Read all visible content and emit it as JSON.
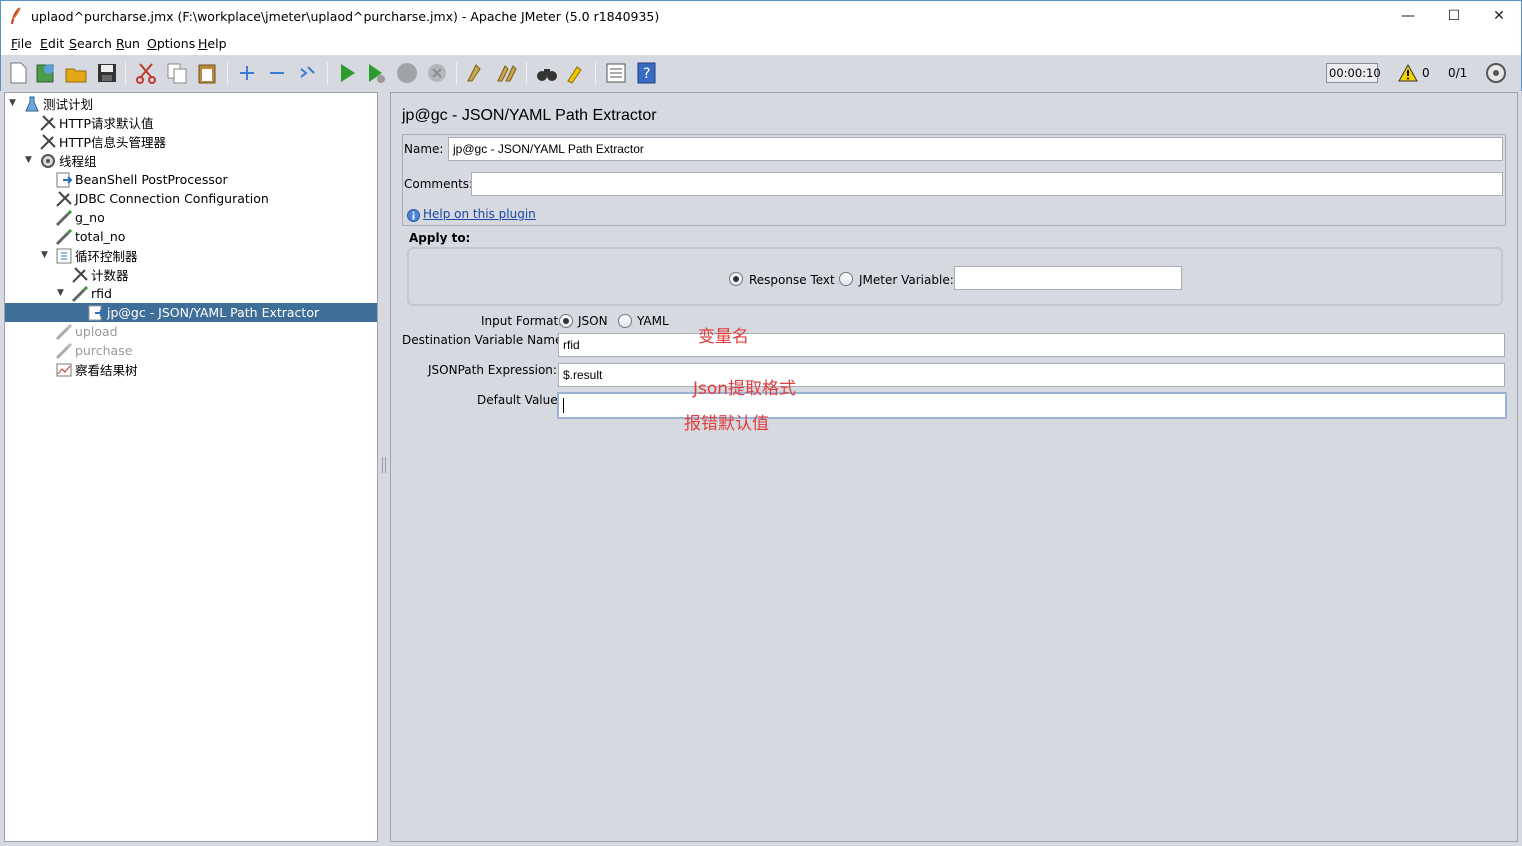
{
  "window": {
    "title": "uplaod^purcharse.jmx (F:\\workplace\\jmeter\\uplaod^purcharse.jmx) - Apache JMeter (5.0 r1840935)",
    "minimize": "—",
    "maximize": "☐",
    "close": "✕"
  },
  "menu": {
    "file": "File",
    "edit": "Edit",
    "search": "Search",
    "run": "Run",
    "options": "Options",
    "help": "Help"
  },
  "toolbar": {
    "timer": "00:00:10",
    "warning_count": "0",
    "threads": "0/1"
  },
  "tree": {
    "items": [
      {
        "label": "测试计划"
      },
      {
        "label": "HTTP请求默认值"
      },
      {
        "label": "HTTP信息头管理器"
      },
      {
        "label": "线程组"
      },
      {
        "label": "BeanShell PostProcessor"
      },
      {
        "label": "JDBC Connection Configuration"
      },
      {
        "label": "g_no"
      },
      {
        "label": "total_no"
      },
      {
        "label": "循环控制器"
      },
      {
        "label": "计数器"
      },
      {
        "label": "rfid"
      },
      {
        "label": "jp@gc - JSON/YAML Path Extractor"
      },
      {
        "label": "upload"
      },
      {
        "label": "purchase"
      },
      {
        "label": "察看结果树"
      }
    ]
  },
  "editor": {
    "title": "jp@gc - JSON/YAML Path Extractor",
    "name_label": "Name:",
    "name_value": "jp@gc - JSON/YAML Path Extractor",
    "comments_label": "Comments:",
    "comments_value": "",
    "help_link": "Help on this plugin",
    "apply_to_label": "Apply to:",
    "response_text_label": "Response Text",
    "jmeter_variable_label": "JMeter Variable:",
    "jmeter_variable_value": "",
    "input_format_label": "Input Format:",
    "json_label": "JSON",
    "yaml_label": "YAML",
    "dest_var_label": "Destination Variable Name:",
    "dest_var_value": "rfid",
    "jsonpath_label": "JSONPath Expression:",
    "jsonpath_value": "$.result",
    "default_label": "Default Value:",
    "default_value": ""
  },
  "annotations": {
    "var_name": "变量名",
    "json_format": "Json提取格式",
    "default_error": "报错默认值"
  }
}
